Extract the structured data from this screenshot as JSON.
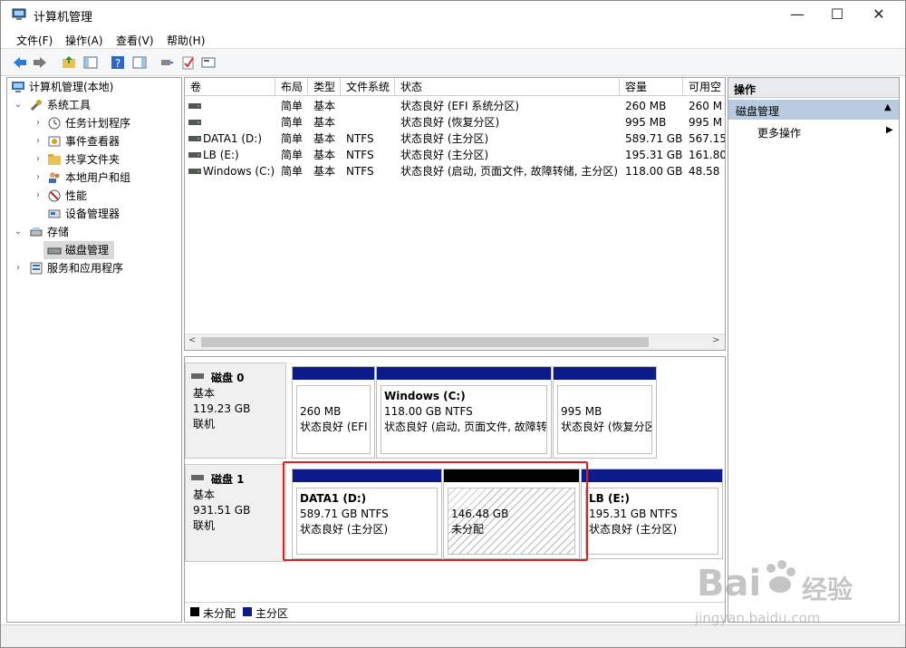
{
  "window": {
    "title": "计算机管理"
  },
  "menu": [
    "文件(F)",
    "操作(A)",
    "查看(V)",
    "帮助(H)"
  ],
  "tree": {
    "root": "计算机管理(本地)",
    "system_tools": "系统工具",
    "task_scheduler": "任务计划程序",
    "event_viewer": "事件查看器",
    "shared_folders": "共享文件夹",
    "local_users": "本地用户和组",
    "performance": "性能",
    "device_manager": "设备管理器",
    "storage": "存储",
    "disk_management": "磁盘管理",
    "services_apps": "服务和应用程序"
  },
  "volume_table": {
    "headers": [
      "卷",
      "布局",
      "类型",
      "文件系统",
      "状态",
      "容量",
      "可用空"
    ],
    "rows": [
      [
        "",
        "简单",
        "基本",
        "",
        "状态良好 (EFI 系统分区)",
        "260 MB",
        "260 M"
      ],
      [
        "",
        "简单",
        "基本",
        "",
        "状态良好 (恢复分区)",
        "995 MB",
        "995 M"
      ],
      [
        "DATA1 (D:)",
        "简单",
        "基本",
        "NTFS",
        "状态良好 (主分区)",
        "589.71 GB",
        "567.15"
      ],
      [
        "LB (E:)",
        "简单",
        "基本",
        "NTFS",
        "状态良好 (主分区)",
        "195.31 GB",
        "161.80"
      ],
      [
        "Windows (C:)",
        "简单",
        "基本",
        "NTFS",
        "状态良好 (启动, 页面文件, 故障转储, 主分区)",
        "118.00 GB",
        "48.58"
      ]
    ]
  },
  "disks": [
    {
      "name": "磁盘 0",
      "type": "基本",
      "size": "119.23 GB",
      "status": "联机",
      "partitions": [
        {
          "title": "",
          "size": "260 MB",
          "status": "状态良好 (EFI"
        },
        {
          "title": "Windows  (C:)",
          "size": "118.00 GB NTFS",
          "status": "状态良好 (启动, 页面文件, 故障转"
        },
        {
          "title": "",
          "size": "995 MB",
          "status": "状态良好 (恢复分区"
        }
      ]
    },
    {
      "name": "磁盘 1",
      "type": "基本",
      "size": "931.51 GB",
      "status": "联机",
      "partitions": [
        {
          "title": "DATA1  (D:)",
          "size": "589.71 GB NTFS",
          "status": "状态良好 (主分区)"
        },
        {
          "title": "",
          "size": "146.48 GB",
          "status": "未分配"
        },
        {
          "title": "LB  (E:)",
          "size": "195.31 GB NTFS",
          "status": "状态良好 (主分区)"
        }
      ]
    }
  ],
  "legend": {
    "unallocated": "未分配",
    "primary": "主分区"
  },
  "actions": {
    "header": "操作",
    "section": "磁盘管理",
    "more": "更多操作"
  },
  "watermark": {
    "brand": "Bai",
    "cn": "经验",
    "url": "jingyan.baidu.com"
  },
  "colors": {
    "primary_partition": "#0c1a8a",
    "unallocated": "#000000",
    "highlight_box": "#e02020"
  }
}
